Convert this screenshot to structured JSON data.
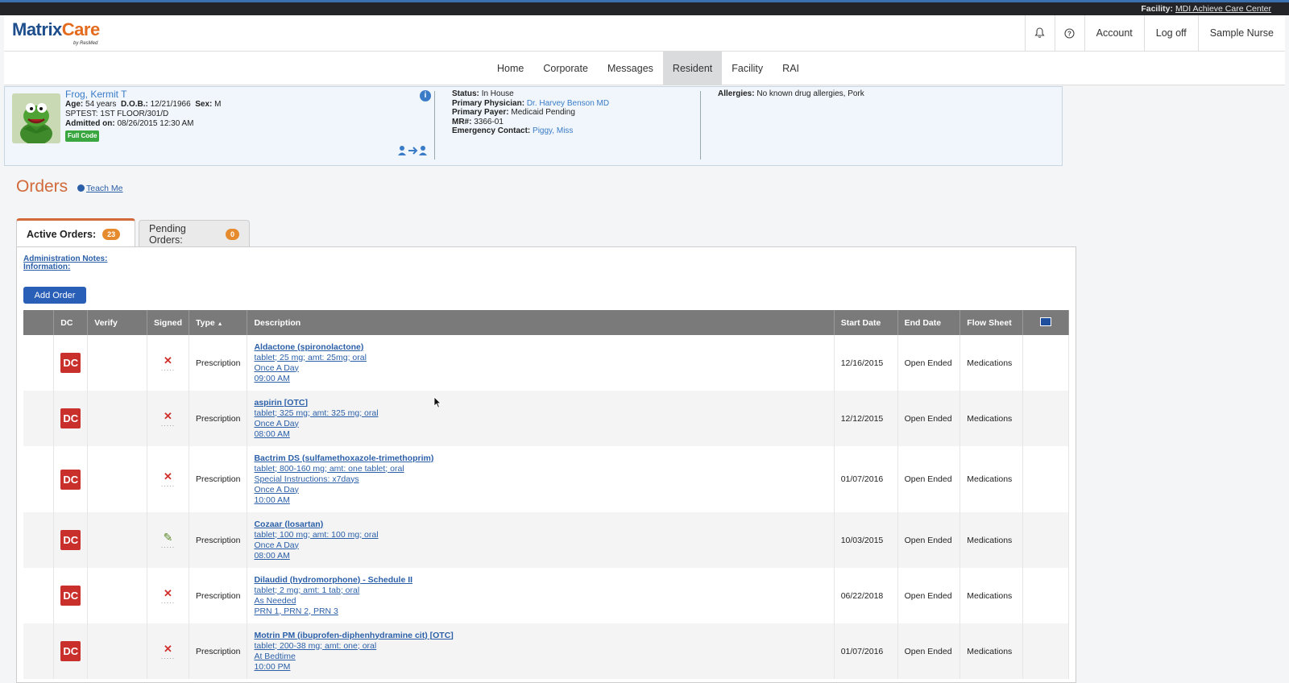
{
  "topbar": {
    "facility_label": "Facility:",
    "facility_name": "MDI Achieve Care Center"
  },
  "brand": {
    "logo_main": "Matrix",
    "logo_accent": "Care",
    "logo_sub": "by ResMed"
  },
  "header": {
    "bell_icon": "bell-icon",
    "help_icon": "help-icon",
    "account": "Account",
    "logoff": "Log off",
    "user": "Sample Nurse"
  },
  "nav": {
    "items": [
      "Home",
      "Corporate",
      "Messages",
      "Resident",
      "Facility",
      "RAI"
    ],
    "active": "Resident"
  },
  "resident": {
    "name": "Frog, Kermit T",
    "age_label": "Age:",
    "age": "54 years",
    "dob_label": "D.O.B.:",
    "dob": "12/21/1966",
    "sex_label": "Sex:",
    "sex": "M",
    "location": "SPTEST: 1ST FLOOR/301/D",
    "admitted_label": "Admitted on:",
    "admitted": "08/26/2015 12:30 AM",
    "code": "Full Code",
    "status_label": "Status:",
    "status": "In House",
    "physician_label": "Primary Physician:",
    "physician": "Dr. Harvey Benson MD",
    "payer_label": "Primary Payer:",
    "payer": "Medicaid Pending",
    "mr_label": "MR#:",
    "mr": "3366-01",
    "emergency_label": "Emergency Contact:",
    "emergency": "Piggy, Miss",
    "allergies_label": "Allergies:",
    "allergies": "No known drug allergies, Pork"
  },
  "orders": {
    "title": "Orders",
    "teach_me": "Teach Me",
    "tab_active_label": "Active Orders:",
    "tab_active_count": "23",
    "tab_pending_label": "Pending Orders:",
    "tab_pending_count": "0",
    "admin_notes_1": "Administration Notes:",
    "admin_notes_2": "Information:",
    "add_order": "Add Order",
    "columns": [
      "",
      "DC",
      "Verify",
      "Signed",
      "Type",
      "Description",
      "Start Date",
      "End Date",
      "Flow Sheet",
      ""
    ],
    "type_sort_indicator": "▲",
    "rows": [
      {
        "dc": "DC",
        "signed": "x",
        "type": "Prescription",
        "desc": [
          "Aldactone (spironolactone)",
          "tablet; 25 mg; amt: 25mg; oral",
          "Once A Day",
          "09:00 AM"
        ],
        "start": "12/16/2015",
        "end": "Open Ended",
        "flow": "Medications"
      },
      {
        "dc": "DC",
        "signed": "x",
        "type": "Prescription",
        "desc": [
          "aspirin [OTC]",
          "tablet; 325 mg; amt: 325 mg; oral",
          "Once A Day",
          "08:00 AM"
        ],
        "start": "12/12/2015",
        "end": "Open Ended",
        "flow": "Medications"
      },
      {
        "dc": "DC",
        "signed": "x",
        "type": "Prescription",
        "desc": [
          "Bactrim DS (sulfamethoxazole-trimethoprim)",
          "tablet; 800-160 mg; amt: one tablet; oral",
          "Special Instructions: x7days",
          "Once A Day",
          "10:00 AM"
        ],
        "start": "01/07/2016",
        "end": "Open Ended",
        "flow": "Medications"
      },
      {
        "dc": "DC",
        "signed": "check",
        "type": "Prescription",
        "desc": [
          "Cozaar (losartan)",
          "tablet; 100 mg; amt: 100 mg; oral",
          "Once A Day",
          "08:00 AM"
        ],
        "start": "10/03/2015",
        "end": "Open Ended",
        "flow": "Medications"
      },
      {
        "dc": "DC",
        "signed": "x",
        "type": "Prescription",
        "desc": [
          "Dilaudid (hydromorphone) - Schedule II",
          "tablet; 2 mg; amt: 1 tab; oral",
          "As Needed",
          "PRN 1, PRN 2, PRN 3"
        ],
        "start": "06/22/2018",
        "end": "Open Ended",
        "flow": "Medications"
      },
      {
        "dc": "DC",
        "signed": "x",
        "type": "Prescription",
        "desc": [
          "Motrin PM (ibuprofen-diphenhydramine cit) [OTC]",
          "tablet; 200-38 mg; amt: one; oral",
          "At Bedtime",
          "10:00 PM"
        ],
        "start": "01/07/2016",
        "end": "Open Ended",
        "flow": "Medications"
      }
    ]
  }
}
